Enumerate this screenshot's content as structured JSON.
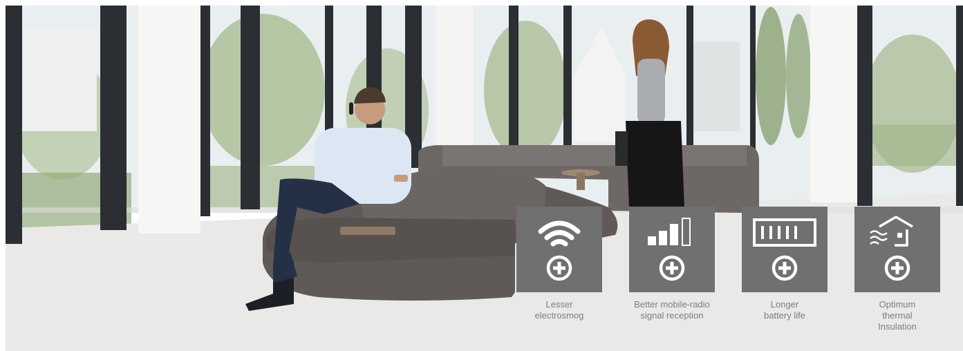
{
  "colors": {
    "tile_bg": "#707070",
    "icon": "#ffffff",
    "caption_text": "#7d7d7d"
  },
  "features": [
    {
      "icon": "wifi-signal-icon",
      "label_lines": [
        "Lesser",
        "electrosmog"
      ]
    },
    {
      "icon": "mobile-signal-bars-icon",
      "label_lines": [
        "Better mobile-radio",
        "signal reception"
      ]
    },
    {
      "icon": "battery-icon",
      "label_lines": [
        "Longer",
        "battery life"
      ]
    },
    {
      "icon": "thermal-house-icon",
      "label_lines": [
        "Optimum",
        "thermal",
        "Insulation"
      ]
    }
  ],
  "plus_icon": "plus-circle-icon"
}
